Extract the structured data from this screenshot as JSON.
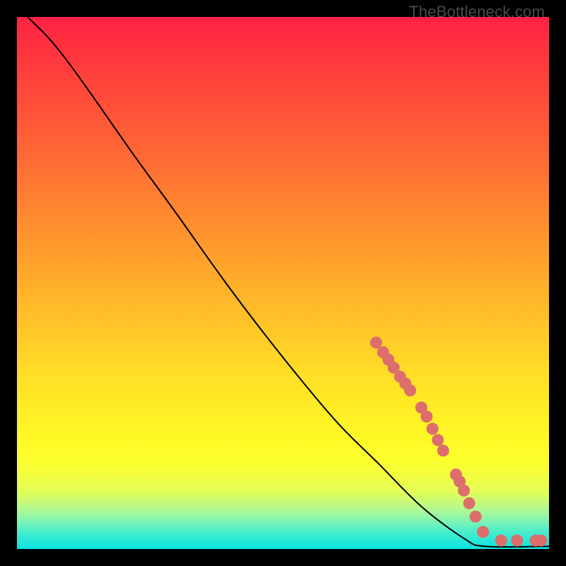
{
  "watermark": "TheBottleneck.com",
  "chart_data": {
    "type": "line",
    "title": "",
    "xlabel": "",
    "ylabel": "",
    "x_range": [
      0,
      100
    ],
    "y_range": [
      0,
      100
    ],
    "curve": {
      "name": "bottleneck-curve",
      "points": [
        {
          "x": 2,
          "y": 100
        },
        {
          "x": 6,
          "y": 96
        },
        {
          "x": 10,
          "y": 91
        },
        {
          "x": 15,
          "y": 84
        },
        {
          "x": 22,
          "y": 74
        },
        {
          "x": 30,
          "y": 63
        },
        {
          "x": 40,
          "y": 49
        },
        {
          "x": 50,
          "y": 36
        },
        {
          "x": 60,
          "y": 24
        },
        {
          "x": 68,
          "y": 16
        },
        {
          "x": 76,
          "y": 8
        },
        {
          "x": 84,
          "y": 2
        },
        {
          "x": 88,
          "y": 0.5
        },
        {
          "x": 100,
          "y": 0.5
        }
      ]
    },
    "markers": {
      "name": "data-points",
      "color": "#dd6e6c",
      "points": [
        {
          "x": 67.5,
          "y": 38.8
        },
        {
          "x": 68.8,
          "y": 37.0
        },
        {
          "x": 69.8,
          "y": 35.6
        },
        {
          "x": 70.8,
          "y": 34.1
        },
        {
          "x": 72.0,
          "y": 32.4
        },
        {
          "x": 73.0,
          "y": 31.1
        },
        {
          "x": 73.9,
          "y": 29.8
        },
        {
          "x": 76.0,
          "y": 26.6
        },
        {
          "x": 77.0,
          "y": 24.9
        },
        {
          "x": 78.1,
          "y": 22.6
        },
        {
          "x": 79.1,
          "y": 20.5
        },
        {
          "x": 80.1,
          "y": 18.5
        },
        {
          "x": 82.5,
          "y": 14.0
        },
        {
          "x": 83.2,
          "y": 12.7
        },
        {
          "x": 84.0,
          "y": 11.0
        },
        {
          "x": 85.0,
          "y": 8.6
        },
        {
          "x": 86.2,
          "y": 6.1
        },
        {
          "x": 87.6,
          "y": 3.2
        },
        {
          "x": 91.0,
          "y": 1.6
        },
        {
          "x": 94.0,
          "y": 1.6
        },
        {
          "x": 97.5,
          "y": 1.6
        },
        {
          "x": 98.5,
          "y": 1.6
        }
      ]
    }
  }
}
